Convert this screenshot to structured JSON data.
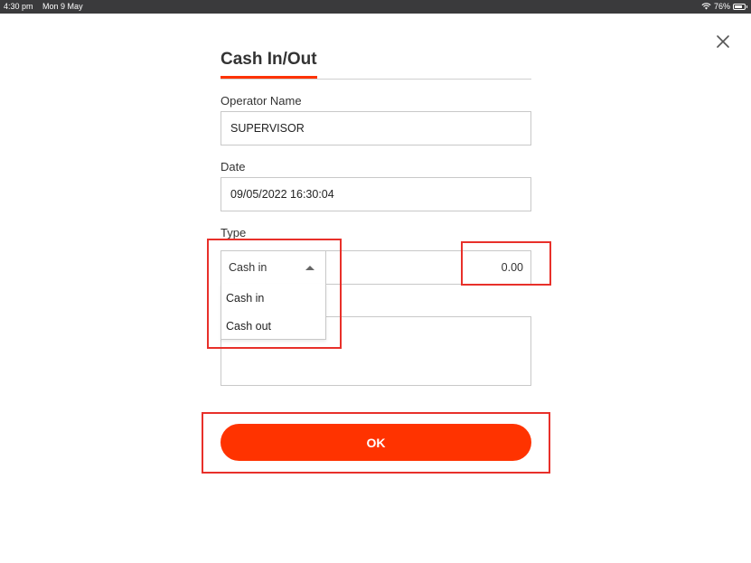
{
  "status_bar": {
    "time": "4:30 pm",
    "date": "Mon 9 May",
    "battery": "76%",
    "battery_level": 0.76
  },
  "dialog": {
    "title": "Cash In/Out",
    "operator_label": "Operator Name",
    "operator_value": "SUPERVISOR",
    "date_label": "Date",
    "date_value": "09/05/2022 16:30:04",
    "type_label": "Type",
    "type_selected": "Cash in",
    "type_options": [
      "Cash in",
      "Cash out"
    ],
    "amount_value": "0.00",
    "ok_label": "OK"
  },
  "colors": {
    "accent": "#ff3300",
    "highlight": "#e8302a"
  },
  "icons": {
    "close": "close-icon",
    "wifi": "wifi-icon",
    "battery": "battery-icon",
    "dropdown": "caret-up-icon"
  }
}
